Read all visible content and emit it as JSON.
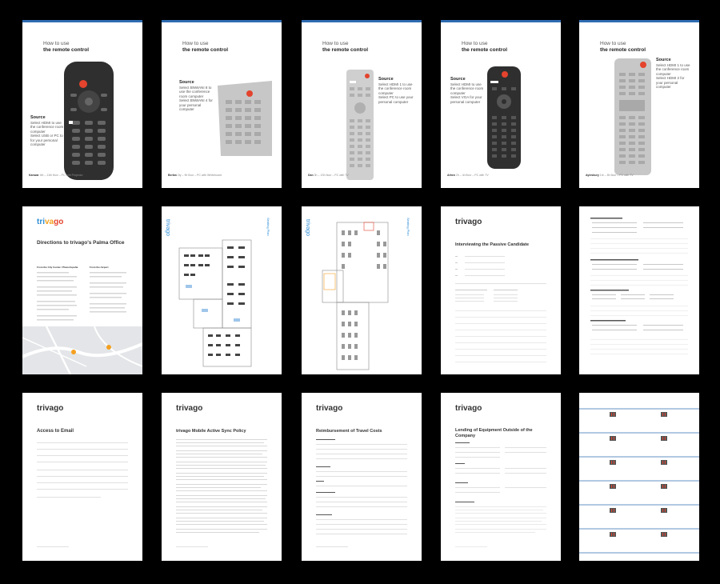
{
  "remote_pages": [
    {
      "title_line1": "How to use",
      "title_line2": "the remote control",
      "source_label": "Source",
      "source_text": "Select HDMI to use the conference room computer",
      "source_text2": "Select USB or PC to for your personal computer",
      "footer_bold": "Kanwar",
      "footer_text": "4th – 11th floor – PC with Projector"
    },
    {
      "title_line1": "How to use",
      "title_line2": "the remote control",
      "source_label": "Source",
      "source_text": "Select BNWANI 8 to use the conference room computer",
      "source_text2": "Select BNWANI 4 for your personal computer",
      "footer_bold": "Berlan",
      "footer_text": "2ty – 9h floor – PC with Whiteboard"
    },
    {
      "title_line1": "How to use",
      "title_line2": "the remote control",
      "source_label": "Source",
      "source_text": "Select HDMI 1 to use the conference room computer",
      "source_text2": "Select PC to use your personal computer",
      "footer_bold": "Dan",
      "footer_text": "3h – 1Sh floor – PC with TV"
    },
    {
      "title_line1": "How to use",
      "title_line2": "the remote control",
      "source_label": "Source",
      "source_text": "Select HDMI to use the conference room computer",
      "source_text2": "Select VGA for your personal computer",
      "footer_bold": "Athen",
      "footer_text": "2h – 4h floor – PC with TV"
    },
    {
      "title_line1": "How to use",
      "title_line2": "the remote control",
      "source_label": "Source",
      "source_text": "Select HDMI 1 to use the conference room computer",
      "source_text2": "Select HDMI 2 for your personal computer",
      "footer_bold": "Aylesbury",
      "footer_text": "1hr – 8h floor – PC with TV"
    }
  ],
  "brand": {
    "logo_part1": "tri",
    "logo_part2": "va",
    "logo_part3": "go",
    "logo_full": "trivago",
    "accent": "#2f6cb3"
  },
  "directions": {
    "title": "Directions to trivago's Palma Office",
    "col1": "From the City Center / Plaza España",
    "col2": "From the Airport"
  },
  "interview": {
    "title": "Interviewing the Passive Candidate"
  },
  "access": {
    "title": "Access to Email"
  },
  "mobile": {
    "title": "trivago Mobile Active Sync Policy"
  },
  "travel": {
    "title": "Reimbursement of Travel Costs"
  },
  "lending": {
    "title": "Lending of Equipment Outside of the Company"
  },
  "colors": {
    "dark_remote": "#2f2f2f",
    "light_remote": "#c7c7c7",
    "red_button": "#e4432d",
    "page_bg": "#ffffff",
    "background": "#000000"
  }
}
